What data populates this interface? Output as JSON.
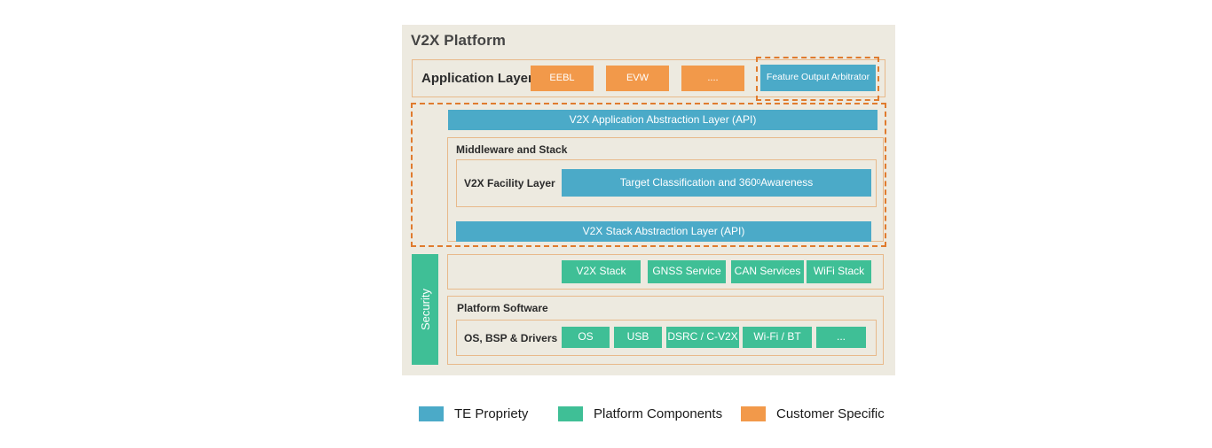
{
  "diagram": {
    "title": "V2X Platform",
    "colors": {
      "te_propriety_blue": "#4BAAC8",
      "platform_components_green": "#3FBF96",
      "customer_specific_orange": "#F2994A",
      "panel_background": "#EDEAE0",
      "solid_border": "#E8B98A",
      "dashed_border": "#E07B2E"
    },
    "security": {
      "label": "Security"
    },
    "application_layer": {
      "label": "Application Layer",
      "apps": [
        {
          "label": "EEBL",
          "color": "orange"
        },
        {
          "label": "EVW",
          "color": "orange"
        },
        {
          "label": "....",
          "color": "orange"
        }
      ],
      "arbitrator": {
        "label": "Feature Output Arbitrator",
        "color": "blue"
      }
    },
    "app_abstraction": {
      "label": "V2X Application Abstraction Layer (API)",
      "color": "blue"
    },
    "middleware": {
      "label": "Middleware and Stack",
      "facility": {
        "label": "V2X Facility Layer",
        "box": {
          "label_prefix": "Target  Classification and 360",
          "label_superscript": "0",
          "label_suffix": " Awareness",
          "color": "blue"
        }
      },
      "stack_abstraction": {
        "label": "V2X Stack Abstraction Layer (API)",
        "color": "blue"
      }
    },
    "stack_services": [
      {
        "label": "V2X Stack",
        "color": "green"
      },
      {
        "label": "GNSS Service",
        "color": "green"
      },
      {
        "label": "CAN Services",
        "color": "green"
      },
      {
        "label": "WiFi Stack",
        "color": "green"
      }
    ],
    "platform_software": {
      "label": "Platform Software",
      "drivers_label": "OS, BSP & Drivers",
      "drivers": [
        {
          "label": "OS",
          "color": "green"
        },
        {
          "label": "USB",
          "color": "green"
        },
        {
          "label": "DSRC / C-V2X",
          "color": "green"
        },
        {
          "label": "Wi-Fi / BT",
          "color": "green"
        },
        {
          "label": "...",
          "color": "green"
        }
      ]
    },
    "legend": [
      {
        "label": "TE Propriety",
        "color": "#4BAAC8"
      },
      {
        "label": "Platform Components",
        "color": "#3FBF96"
      },
      {
        "label": "Customer Specific",
        "color": "#F2994A"
      }
    ]
  }
}
